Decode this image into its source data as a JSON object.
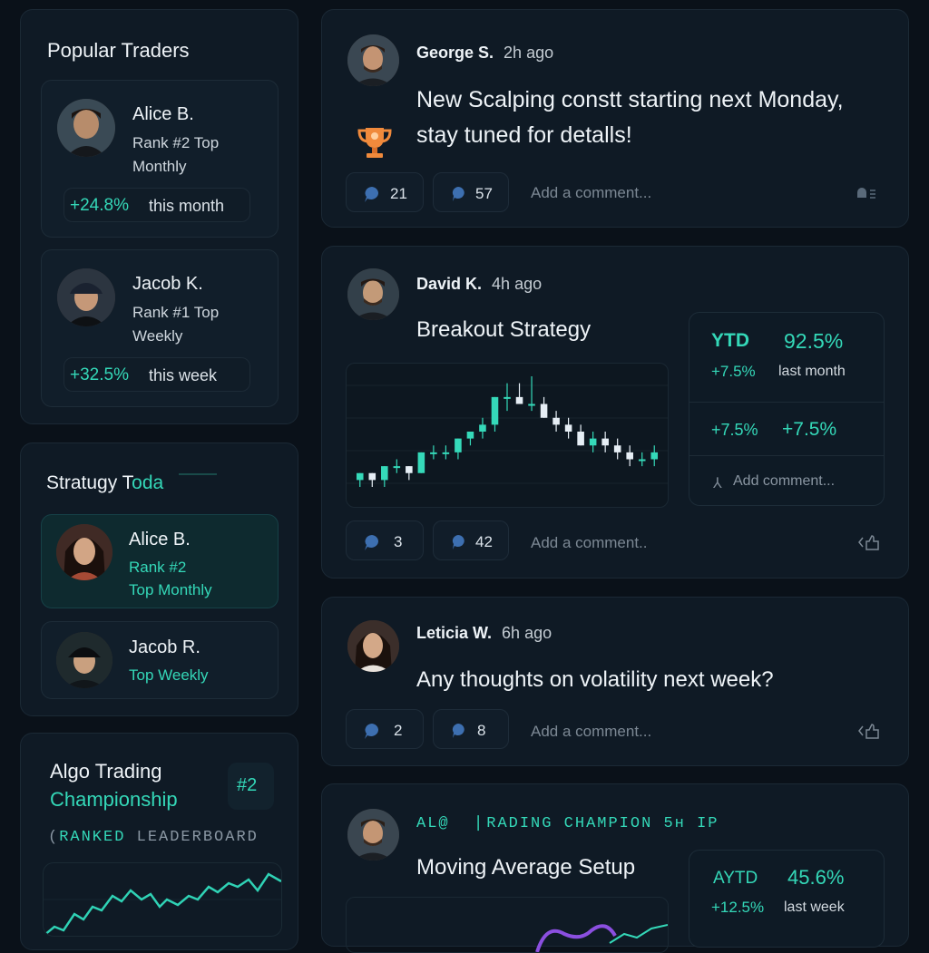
{
  "sidebar": {
    "popular": {
      "title": "Popular Traders",
      "traders": [
        {
          "name": "Alice B.",
          "rank": "Rank #2 Top",
          "period": "Monthly",
          "change": "+24.8%",
          "change_label": "this month"
        },
        {
          "name": "Jacob K.",
          "rank": "Rank #1 Top",
          "period": "Weekly",
          "change": "+32.5%",
          "change_label": "this week"
        }
      ]
    },
    "strategy": {
      "title_white": "Stratugy T",
      "title_teal": "oda",
      "traders": [
        {
          "name": "Alice B.",
          "rank": "Rank #2",
          "period": "Top Monthly"
        },
        {
          "name": "Jacob R.",
          "period": "Top Weekly"
        }
      ]
    },
    "championship": {
      "title_line1": "Algo Trading",
      "title_line2": "Championship",
      "badge": "#2",
      "label_teal": "RANKED",
      "label_muted": "LEADERBOARD",
      "prefix": "("
    }
  },
  "posts": [
    {
      "author": "George S.",
      "time": "2h ago",
      "text_line1": "New Scalping constt starting next Monday,",
      "text_line2": "stay tuned for detalls!",
      "comments": "21",
      "likes": "57",
      "comment_placeholder": "Add a comment..."
    },
    {
      "author": "David K.",
      "time": "4h ago",
      "title": "Breakout Strategy",
      "stats": {
        "ytd_label": "YTD",
        "ytd_value": "92.5%",
        "month_change": "+7.5%",
        "month_label": "last month",
        "row2_a": "+7.5%",
        "row2_b": "+7.5%",
        "comment_placeholder": "Add comment..."
      },
      "comments": "3",
      "likes": "42",
      "comment_placeholder": "Add a comment.."
    },
    {
      "author": "Leticia W.",
      "time": "6h ago",
      "text": "Any thoughts on volatility next week?",
      "comments": "2",
      "likes": "8",
      "comment_placeholder": "Add a comment..."
    },
    {
      "header": "AL@  ❘RADING CHAMPION 5н IP",
      "title": "Moving Average Setup",
      "stats": {
        "ytd_label": "AYTD",
        "ytd_value": "45.6%",
        "week_change": "+12.5%",
        "week_label": "last week"
      }
    }
  ],
  "chart_data": {
    "type": "candlestick",
    "title": "",
    "candles": [
      [
        5,
        6,
        4,
        6
      ],
      [
        6,
        6,
        4,
        5
      ],
      [
        5,
        7,
        4,
        7
      ],
      [
        7,
        8,
        6,
        7
      ],
      [
        7,
        7,
        5,
        6
      ],
      [
        6,
        9,
        6,
        9
      ],
      [
        9,
        10,
        8,
        9
      ],
      [
        9,
        10,
        8,
        9
      ],
      [
        9,
        11,
        8,
        11
      ],
      [
        11,
        12,
        10,
        12
      ],
      [
        12,
        14,
        11,
        13
      ],
      [
        13,
        17,
        12,
        17
      ],
      [
        17,
        19,
        15,
        17
      ],
      [
        17,
        19,
        16,
        16
      ],
      [
        16,
        20,
        15,
        16
      ],
      [
        16,
        17,
        14,
        14
      ],
      [
        14,
        15,
        12,
        13
      ],
      [
        13,
        14,
        11,
        12
      ],
      [
        12,
        13,
        10,
        10
      ],
      [
        10,
        12,
        9,
        11
      ],
      [
        11,
        12,
        9,
        10
      ],
      [
        10,
        11,
        8,
        9
      ],
      [
        9,
        10,
        7,
        8
      ],
      [
        8,
        9,
        7,
        8
      ],
      [
        8,
        10,
        7,
        9
      ]
    ],
    "palette": {
      "up": "#35d9b9",
      "down": "#e6eef5",
      "accent": "#f08a3c"
    }
  },
  "colors": {
    "accent": "#34d8b8",
    "background": "#0a1119",
    "card": "#0f1a25"
  },
  "icons": [
    "trophy-icon",
    "comment-icon",
    "like-icon",
    "share-icon"
  ]
}
